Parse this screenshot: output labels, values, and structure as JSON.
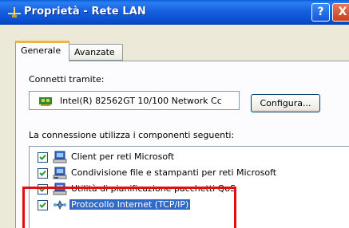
{
  "window": {
    "title": "Proprietà - Rete LAN",
    "help_label": "?",
    "close_label": "X"
  },
  "tabs": [
    {
      "label": "Generale",
      "active": true
    },
    {
      "label": "Avanzate",
      "active": false
    }
  ],
  "general": {
    "connect_using_label": "Connetti tramite:",
    "adapter_name": "Intel(R) 82562GT 10/100 Network Cc",
    "configure_button": "Configura...",
    "components_label": "La connessione utilizza i componenti seguenti:",
    "components": [
      {
        "label": "Client per reti Microsoft",
        "checked": true,
        "icon": "network-client-icon"
      },
      {
        "label": "Condivisione file e stampanti per reti Microsoft",
        "checked": true,
        "icon": "file-printer-sharing-icon"
      },
      {
        "label": "Utilità di pianificazione pacchetti QoS",
        "checked": true,
        "icon": "qos-scheduler-icon"
      },
      {
        "label": "Protocollo Internet (TCP/IP)",
        "checked": true,
        "icon": "protocol-icon",
        "selected": true
      }
    ]
  },
  "colors": {
    "titlebar": "#0a4fd0",
    "selection": "#316ac5",
    "annotation": "#e01010"
  }
}
